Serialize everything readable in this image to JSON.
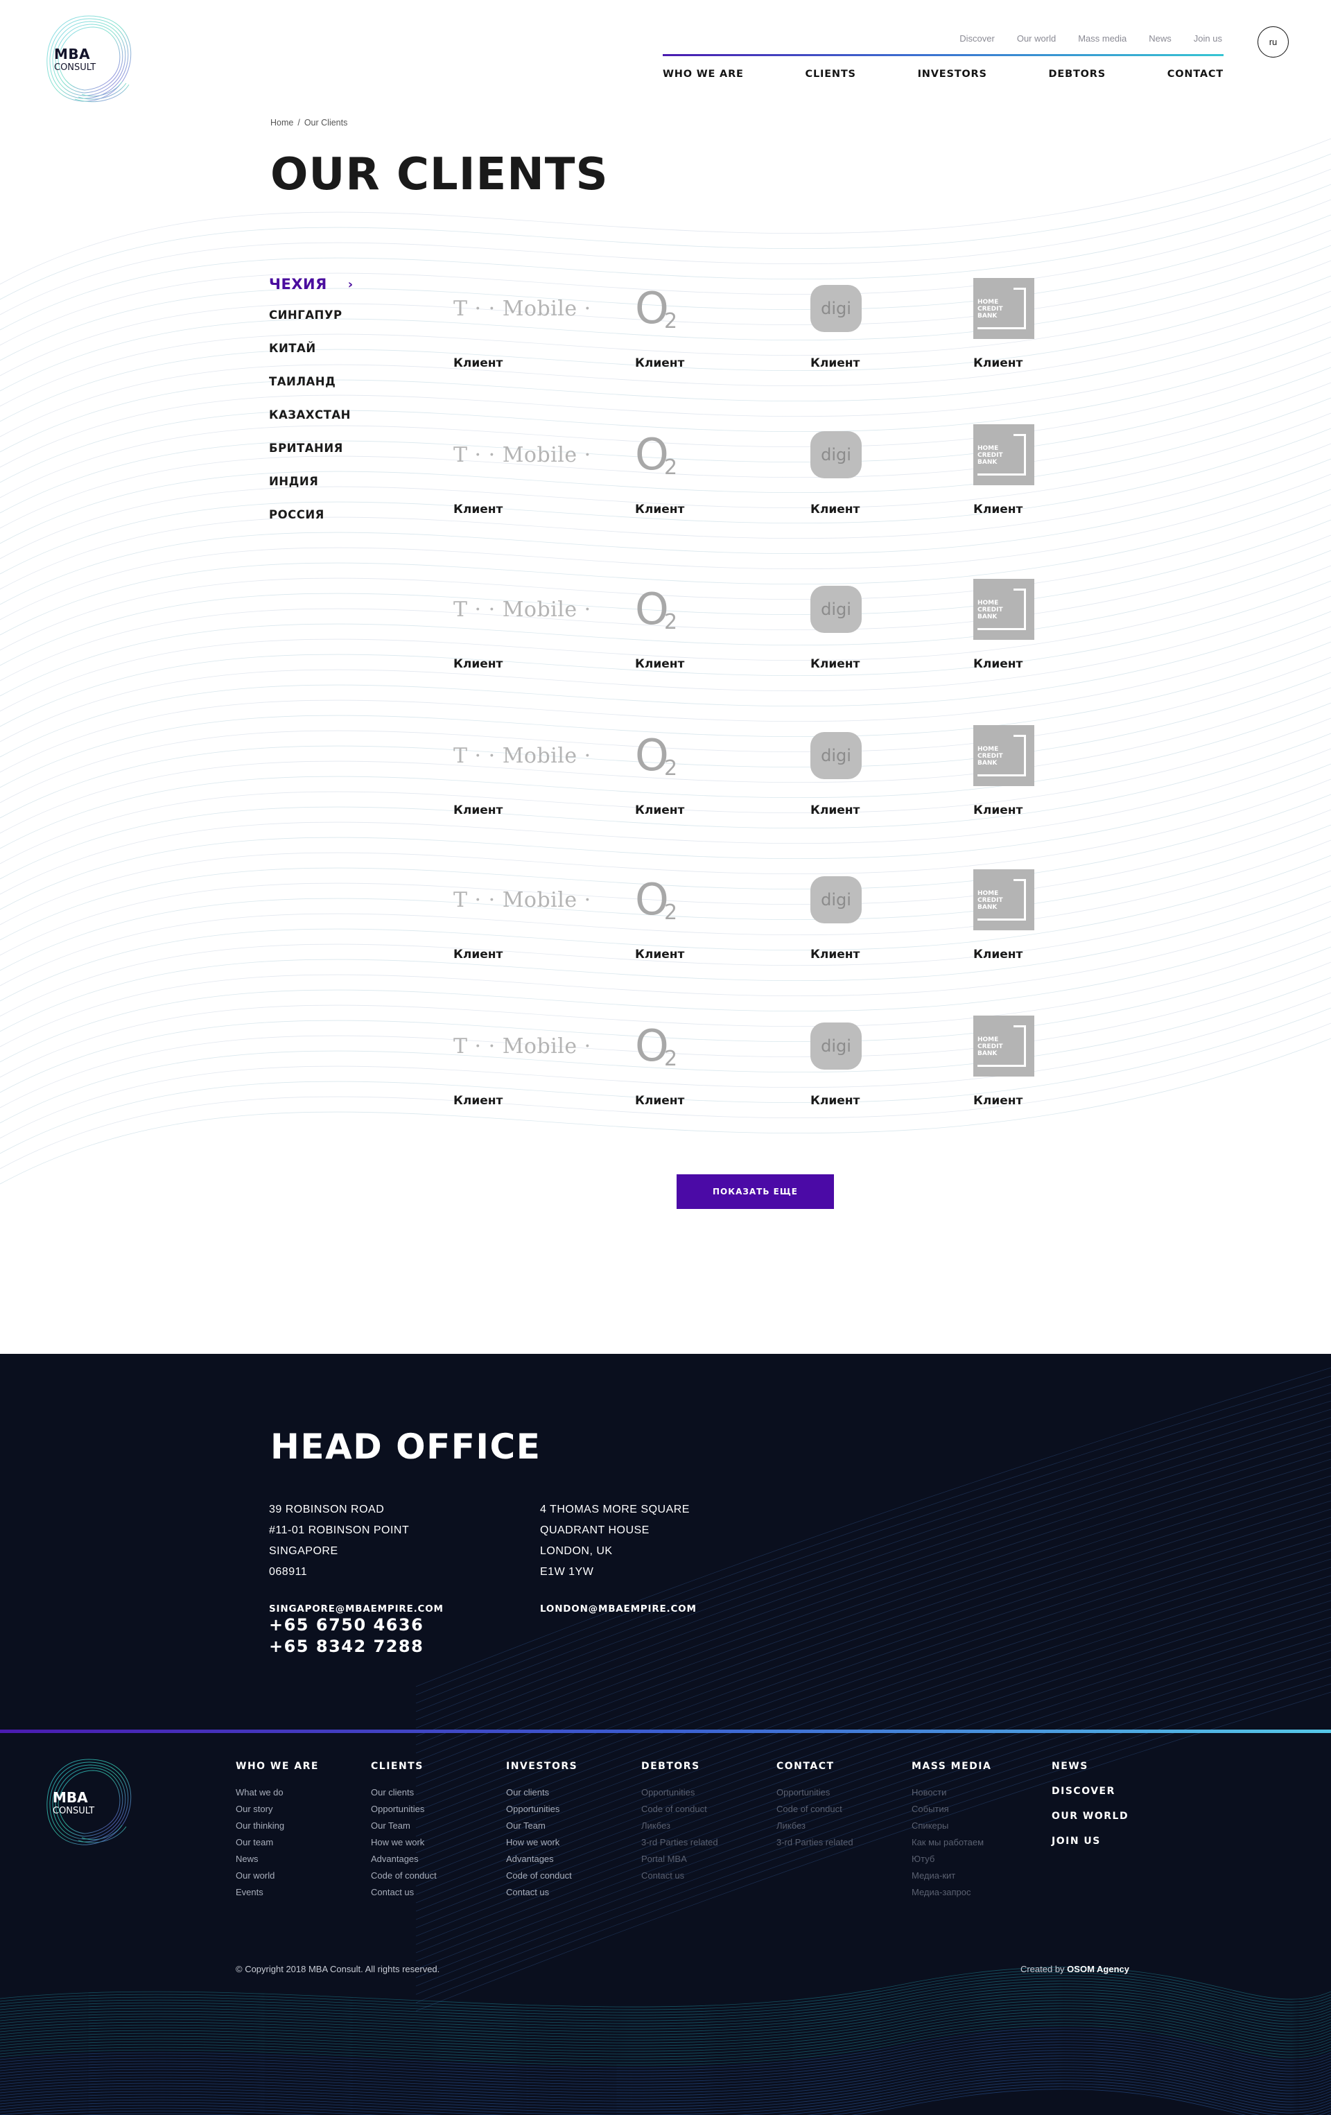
{
  "brand": {
    "name_top": "MBA",
    "name_bottom": "CONSULT",
    "accent": "#4b0aa6",
    "footer_bg": "#0a0f1e"
  },
  "top_links": [
    "Discover",
    "Our world",
    "Mass media",
    "News",
    "Join us"
  ],
  "main_nav": [
    "WHO WE ARE",
    "CLIENTS",
    "INVESTORS",
    "DEBTORS",
    "CONTACT"
  ],
  "lang": "ru",
  "breadcrumb": {
    "home": "Home",
    "sep": "/",
    "current": "Our Clients"
  },
  "page_title": "OUR CLIENTS",
  "countries": [
    "ЧЕХИЯ",
    "СИНГАПУР",
    "КИТАЙ",
    "ТАИЛАНД",
    "КАЗАХСТАН",
    "БРИТАНИЯ",
    "ИНДИЯ",
    "РОССИЯ"
  ],
  "active_country_chevron": "›",
  "client_logos": {
    "tmobile": "T · · Mobile ·",
    "o2_letter": "O",
    "o2_sub": "2",
    "digi": "digi",
    "hcb": [
      "HOME",
      "CREDIT",
      "BANK"
    ]
  },
  "client_label": "Клиент",
  "client_rows": [
    [
      "Клиент",
      "Клиент",
      "Клиент",
      "Клиент"
    ],
    [
      "Клиент",
      "Клиент",
      "Клиент",
      "Клиент"
    ],
    [
      "Клиент",
      "Клиент",
      "Клиент",
      "Клиент"
    ],
    [
      "Клиент",
      "Клиент",
      "Клиент",
      "Клиент"
    ],
    [
      "Клиент",
      "Клиент",
      "Клиент",
      "Клиент"
    ],
    [
      "Клиент",
      "Клиент",
      "Клиент",
      "Клиент"
    ]
  ],
  "more_button": "ПОКАЗАТЬ ЕЩЕ",
  "head_office": {
    "title": "HEAD OFFICE",
    "singapore": {
      "lines": [
        "39 ROBINSON ROAD",
        "#11-01 ROBINSON POINT",
        "SINGAPORE",
        "068911"
      ],
      "email": "SINGAPORE@MBAEMPIRE.COM",
      "phones": [
        "+65 6750 4636",
        "+65 8342 7288"
      ]
    },
    "london": {
      "lines": [
        "4 THOMAS MORE SQUARE",
        "QUADRANT HOUSE",
        "LONDON, UK",
        "E1W 1YW"
      ],
      "email": "LONDON@MBAEMPIRE.COM"
    }
  },
  "footer_columns": [
    {
      "title": "WHO WE ARE",
      "links": [
        "What we do",
        "Our story",
        "Our thinking",
        "Our team",
        "News",
        "Our world",
        "Events"
      ]
    },
    {
      "title": "CLIENTS",
      "links": [
        "Our clients",
        "Opportunities",
        "Our Team",
        "How we work",
        "Advantages",
        "Code of conduct",
        "Contact us"
      ]
    },
    {
      "title": "INVESTORS",
      "links": [
        "Our clients",
        "Opportunities",
        "Our Team",
        "How we work",
        "Advantages",
        "Code of conduct",
        "Contact us"
      ]
    },
    {
      "title": "DEBTORS",
      "links": [
        "Opportunities",
        "Code of conduct",
        "Ликбез",
        "3-rd Parties related",
        "Portal MBA",
        "Contact us"
      ]
    },
    {
      "title": "CONTACT",
      "links": [
        "Opportunities",
        "Code of conduct",
        "Ликбез",
        "3-rd Parties related"
      ]
    },
    {
      "title": "MASS MEDIA",
      "links": [
        "Новости",
        "События",
        "Спикеры",
        "Как мы работаем",
        "Ютуб",
        "Медиа-кит",
        "Медиа-запрос"
      ]
    }
  ],
  "footer_bold_links": [
    "NEWS",
    "DISCOVER",
    "OUR WORLD",
    "JOIN US"
  ],
  "copyright": "© Copyright 2018 MBA Consult. All rights reserved.",
  "created_by": {
    "prefix": "Created by",
    "agency": "OSOM Agency"
  }
}
